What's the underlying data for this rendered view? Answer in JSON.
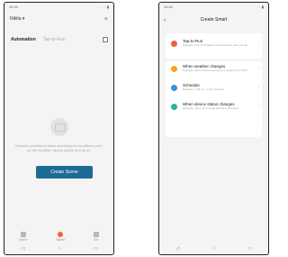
{
  "left_screen": {
    "status": {
      "time": "10:41",
      "right": "… ▮"
    },
    "home_name": "Nikita ▾",
    "tabs": {
      "active": "Automation",
      "inactive": "Tap-to-Run"
    },
    "empty_state": "Execute predefined tasks according to conditions such as the weather, device status and so on",
    "create_button": "Create Scene",
    "bottom_nav": [
      {
        "label": "Home"
      },
      {
        "label": "Scene"
      },
      {
        "label": "Me"
      }
    ],
    "system_nav": [
      "◁",
      "○",
      "□"
    ]
  },
  "right_screen": {
    "status": {
      "time": "10:41",
      "right": "… ▮"
    },
    "title": "Create Smart",
    "back_glyph": "‹",
    "options": [
      {
        "title": "Tap-to-Run",
        "desc": "Example: turn off all lights in the bedroom with one tap",
        "color": "#e8633f"
      },
      {
        "title": "When weather changes",
        "desc": "Example: when local temperature is greater than 28°C",
        "color": "#f5a623"
      },
      {
        "title": "Schedule",
        "desc": "Example: 7:00 a.m. every morning",
        "color": "#3d8fd8"
      },
      {
        "title": "When device status changes",
        "desc": "Example: when an unusual activity is detected",
        "color": "#2bb3a0"
      }
    ],
    "chevron": "›",
    "system_nav": [
      "◁",
      "○",
      "□"
    ]
  }
}
